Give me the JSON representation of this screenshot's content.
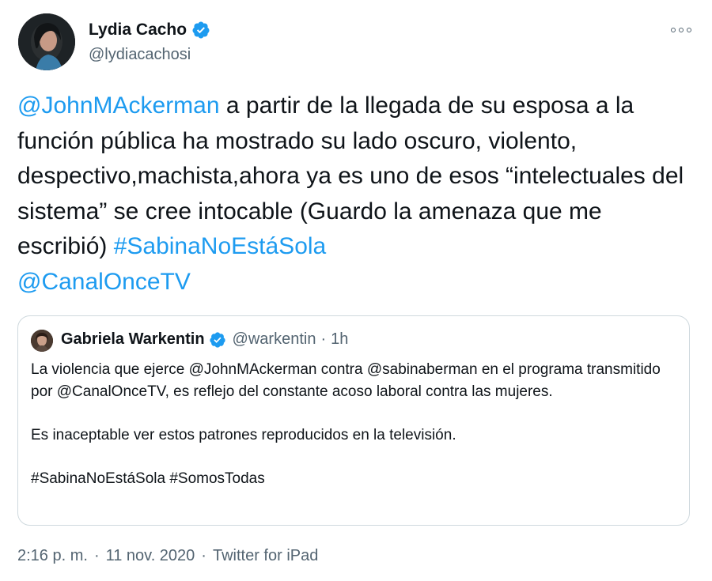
{
  "author": {
    "display_name": "Lydia Cacho",
    "handle": "@lydiacachosi",
    "verified": true,
    "avatar": "portrait-avatar"
  },
  "tweet": {
    "mention_1": "@JohnMAckerman",
    "text_1": " a partir de la llegada de su esposa a la función pública ha mostrado su lado oscuro, violento, despectivo,machista,ahora ya es uno de esos “intelectuales del sistema” se cree intocable (Guardo la amenaza que me escribió) ",
    "hashtag_1": "#SabinaNoEstáSola",
    "mention_2": "@CanalOnceTV"
  },
  "quoted_tweet": {
    "display_name": "Gabriela Warkentin",
    "handle": "@warkentin",
    "separator": "·",
    "time": "1h",
    "paragraph_1": "La violencia que ejerce @JohnMAckerman contra @sabinaberman en el programa transmitido por @CanalOnceTV, es reflejo del constante acoso laboral contra las mujeres.",
    "paragraph_2": "Es inaceptable ver estos patrones reproducidos en la televisión.",
    "paragraph_3": "#SabinaNoEstáSola #SomosTodas"
  },
  "meta": {
    "time": "2:16 p. m.",
    "separator": "·",
    "date": "11 nov. 2020",
    "source": "Twitter for iPad"
  },
  "icons": {
    "more": "more-options-icon",
    "verified": "verified-badge-icon"
  },
  "colors": {
    "link": "#1d9bf0",
    "text": "#0f1419",
    "secondary": "#536471",
    "border": "#cfd9de"
  }
}
